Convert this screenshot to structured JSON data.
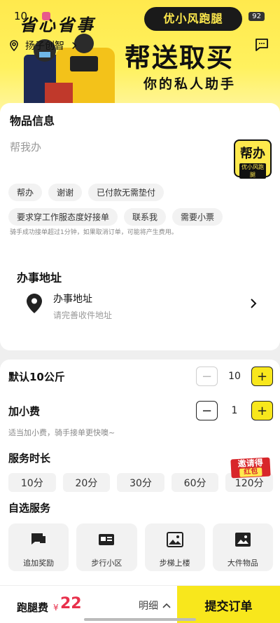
{
  "status": {
    "time": "10",
    "battery": "92"
  },
  "banner": {
    "logo": "省心省事",
    "brand": "优小风跑腿",
    "slogan": "帮送取买",
    "subslogan": "你的私人助手",
    "location": "扬子创智",
    "icons": {
      "location": "location-pin-icon",
      "chat": "chat-bubble-icon"
    }
  },
  "goods": {
    "title": "物品信息",
    "placeholder": "帮我办",
    "logo_main": "帮办",
    "logo_sub": "优小风跑腿",
    "tags": [
      "帮办",
      "谢谢",
      "已付款无需垫付",
      "要求穿工作服态度好接单",
      "联系我",
      "需要小票"
    ],
    "notice": "骑手成功接单超过1分钟，如果取消订单，可能将产生费用。"
  },
  "address": {
    "title": "办事地址",
    "main": "办事地址",
    "sub": "请完善收件地址"
  },
  "options": {
    "weight_label": "默认10公斤",
    "weight_value": "10",
    "tip_label": "加小费",
    "tip_value": "1",
    "tip_hint": "适当加小费，骑手接单更快噢~",
    "duration_label": "服务时长",
    "durations": [
      "10分",
      "20分",
      "30分",
      "60分",
      "120分"
    ],
    "invite_badge_top": "邀请得",
    "invite_badge_bottom": "红包",
    "services_label": "自选服务",
    "services": [
      "追加奖励",
      "步行小区",
      "步梯上楼",
      "大件物品"
    ]
  },
  "footer": {
    "fee_label": "跑腿费",
    "currency": "¥",
    "amount": "22",
    "detail": "明细",
    "submit": "提交订单"
  },
  "colors": {
    "accent": "#f8e71c",
    "price": "#e8314c",
    "background": "#efefef"
  }
}
